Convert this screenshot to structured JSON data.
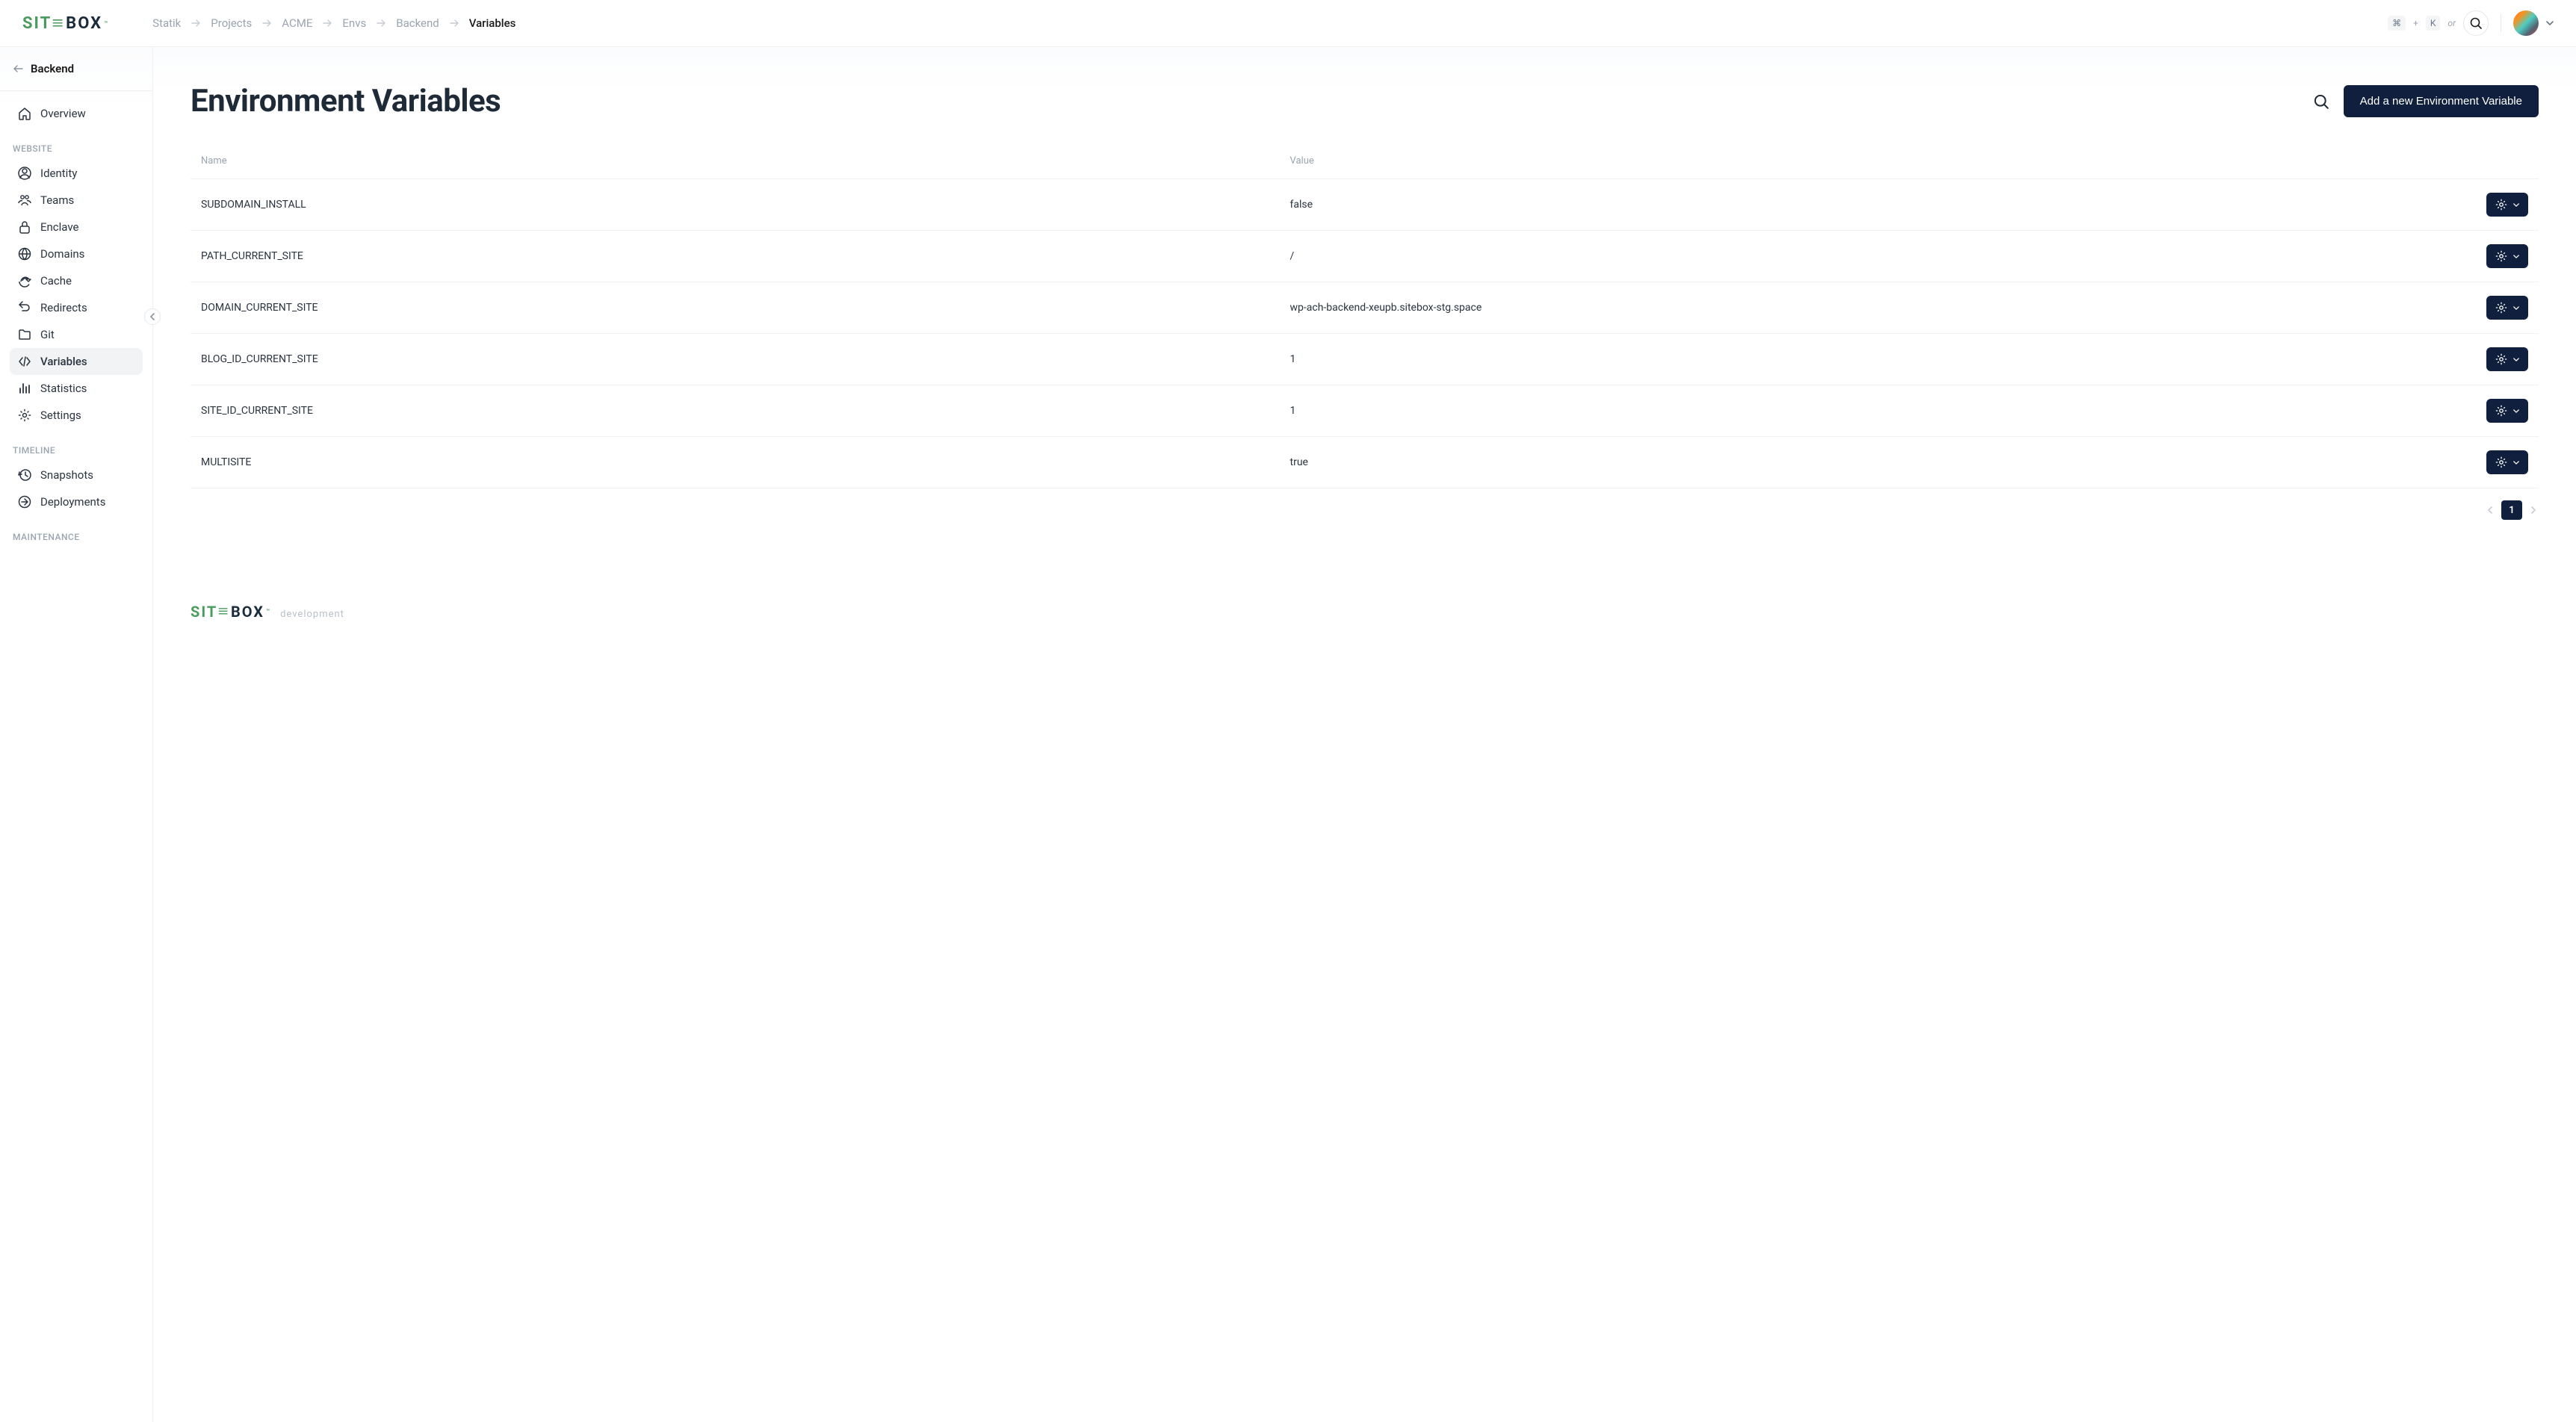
{
  "brand": {
    "green": "SIT",
    "bar": "≡",
    "dark": "BOX",
    "tm": "™"
  },
  "breadcrumbs": [
    {
      "label": "Statik"
    },
    {
      "label": "Projects"
    },
    {
      "label": "ACME"
    },
    {
      "label": "Envs"
    },
    {
      "label": "Backend"
    },
    {
      "label": "Variables",
      "current": true
    }
  ],
  "shortcut": {
    "cmd": "⌘",
    "plus": "+",
    "key": "K",
    "or": "or"
  },
  "backlink": {
    "label": "Backend"
  },
  "sidebar": {
    "overview": "Overview",
    "sections": [
      {
        "heading": "WEBSITE",
        "items": [
          {
            "icon": "identity",
            "label": "Identity"
          },
          {
            "icon": "teams",
            "label": "Teams"
          },
          {
            "icon": "enclave",
            "label": "Enclave"
          },
          {
            "icon": "domains",
            "label": "Domains"
          },
          {
            "icon": "cache",
            "label": "Cache"
          },
          {
            "icon": "redirects",
            "label": "Redirects"
          },
          {
            "icon": "git",
            "label": "Git"
          },
          {
            "icon": "variables",
            "label": "Variables",
            "active": true
          },
          {
            "icon": "stats",
            "label": "Statistics"
          },
          {
            "icon": "settings",
            "label": "Settings"
          }
        ]
      },
      {
        "heading": "TIMELINE",
        "items": [
          {
            "icon": "snapshots",
            "label": "Snapshots"
          },
          {
            "icon": "deployments",
            "label": "Deployments"
          }
        ]
      },
      {
        "heading": "MAINTENANCE",
        "items": []
      }
    ]
  },
  "page": {
    "title": "Environment Variables",
    "add_button": "Add a new Environment Variable",
    "columns": {
      "name": "Name",
      "value": "Value"
    },
    "rows": [
      {
        "name": "SUBDOMAIN_INSTALL",
        "value": "false"
      },
      {
        "name": "PATH_CURRENT_SITE",
        "value": "/"
      },
      {
        "name": "DOMAIN_CURRENT_SITE",
        "value": "wp-ach-backend-xeupb.sitebox-stg.space"
      },
      {
        "name": "BLOG_ID_CURRENT_SITE",
        "value": "1"
      },
      {
        "name": "SITE_ID_CURRENT_SITE",
        "value": "1"
      },
      {
        "name": "MULTISITE",
        "value": "true"
      }
    ],
    "pagination": {
      "current": "1"
    }
  },
  "footer": {
    "env": "development"
  }
}
